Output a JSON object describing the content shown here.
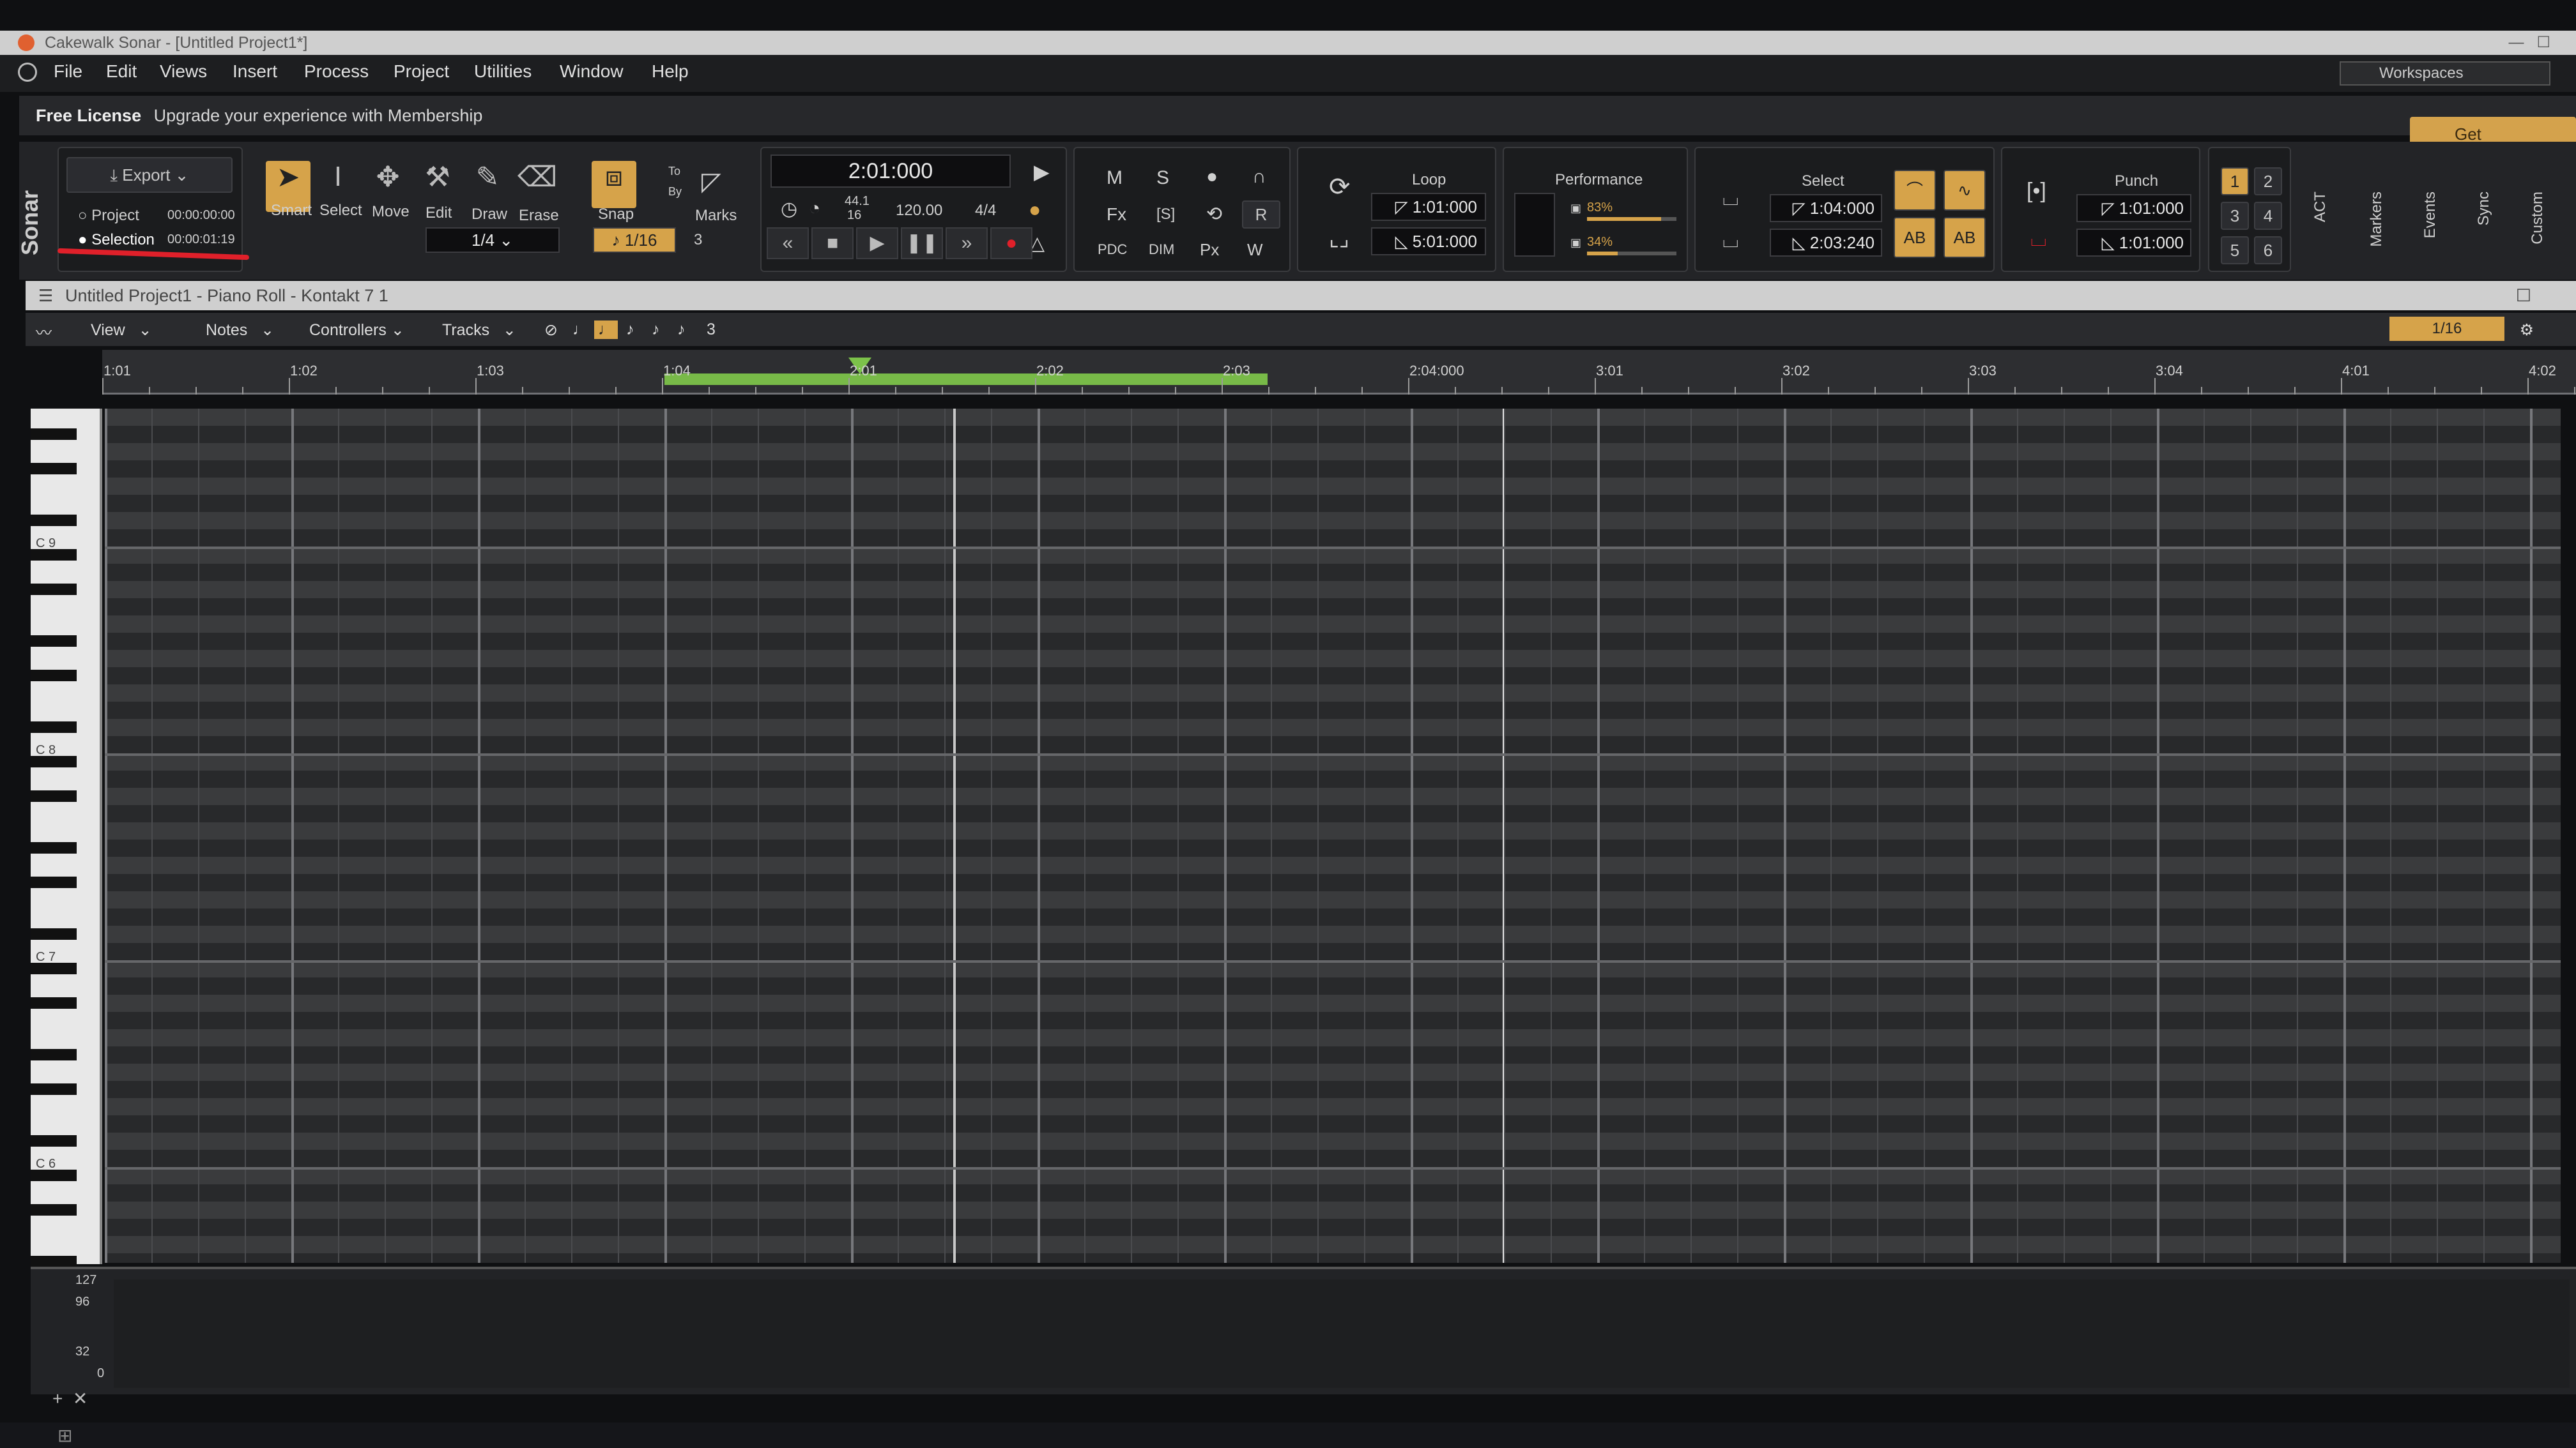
{
  "window": {
    "title": "Cakewalk Sonar - [Untitled Project1*]"
  },
  "menu": [
    "File",
    "Edit",
    "Views",
    "Insert",
    "Process",
    "Project",
    "Utilities",
    "Window",
    "Help"
  ],
  "workspaces_label": "Workspaces",
  "license": {
    "label": "Free License",
    "message": "Upgrade your experience with Membership",
    "get_membership": "Get Membership"
  },
  "brand": "Sonar",
  "export": {
    "label": "Export",
    "project_label": "Project",
    "project_time": "00:00:00:00",
    "selection_label": "Selection",
    "selection_time": "00:00:01:19"
  },
  "tools": [
    "Smart",
    "Select",
    "Move",
    "Edit",
    "Draw",
    "Erase"
  ],
  "duration": "1/4",
  "snap": {
    "label": "Snap",
    "to_label": "To",
    "by_label": "By",
    "marks_label": "Marks",
    "value": "1/16",
    "extra": "3"
  },
  "transport": {
    "time": "2:01:000",
    "sample_rate": "44.1",
    "bit_depth": "16",
    "tempo": "120.00",
    "meter": "4/4"
  },
  "mix": {
    "m": "M",
    "s": "S",
    "fx": "Fx",
    "fxs": "[S]",
    "r": "R",
    "pdc": "PDC",
    "dim": "DIM",
    "px": "Px",
    "w": "W"
  },
  "loop": {
    "label": "Loop",
    "start": "1:01:000",
    "end": "5:01:000"
  },
  "performance": {
    "label": "Performance",
    "cpu": "83%",
    "disk": "34%"
  },
  "select": {
    "label": "Select",
    "start": "1:04:000",
    "end": "2:03:240",
    "ab1": "AB",
    "ab2": "AB"
  },
  "punch": {
    "label": "Punch",
    "start": "1:01:000",
    "end": "1:01:000"
  },
  "screensets": [
    "1",
    "2",
    "3",
    "4",
    "5",
    "6"
  ],
  "sidebar_tabs": [
    "ACT",
    "Markers",
    "Events",
    "Sync",
    "Custom"
  ],
  "piano_roll": {
    "title": "Untitled Project1 - Piano Roll - Kontakt 7 1",
    "toolbar": {
      "view": "View",
      "notes": "Notes",
      "controllers": "Controllers",
      "tracks": "Tracks",
      "triplet": "3",
      "snap": "1/16"
    },
    "ruler": [
      "1:01",
      "1:02",
      "1:03",
      "1:04",
      "2:01",
      "2:02",
      "2:03",
      "2:04:000",
      "3:01",
      "3:02",
      "3:03",
      "3:04",
      "4:01",
      "4:02"
    ],
    "octaves": [
      "C 9",
      "C 8",
      "C 7",
      "C 6"
    ],
    "ctrl_values": [
      "127",
      "96",
      "32",
      "0"
    ]
  },
  "colors": {
    "accent": "#d6a34a",
    "loop": "#7cc24a",
    "record": "#e0202a"
  }
}
